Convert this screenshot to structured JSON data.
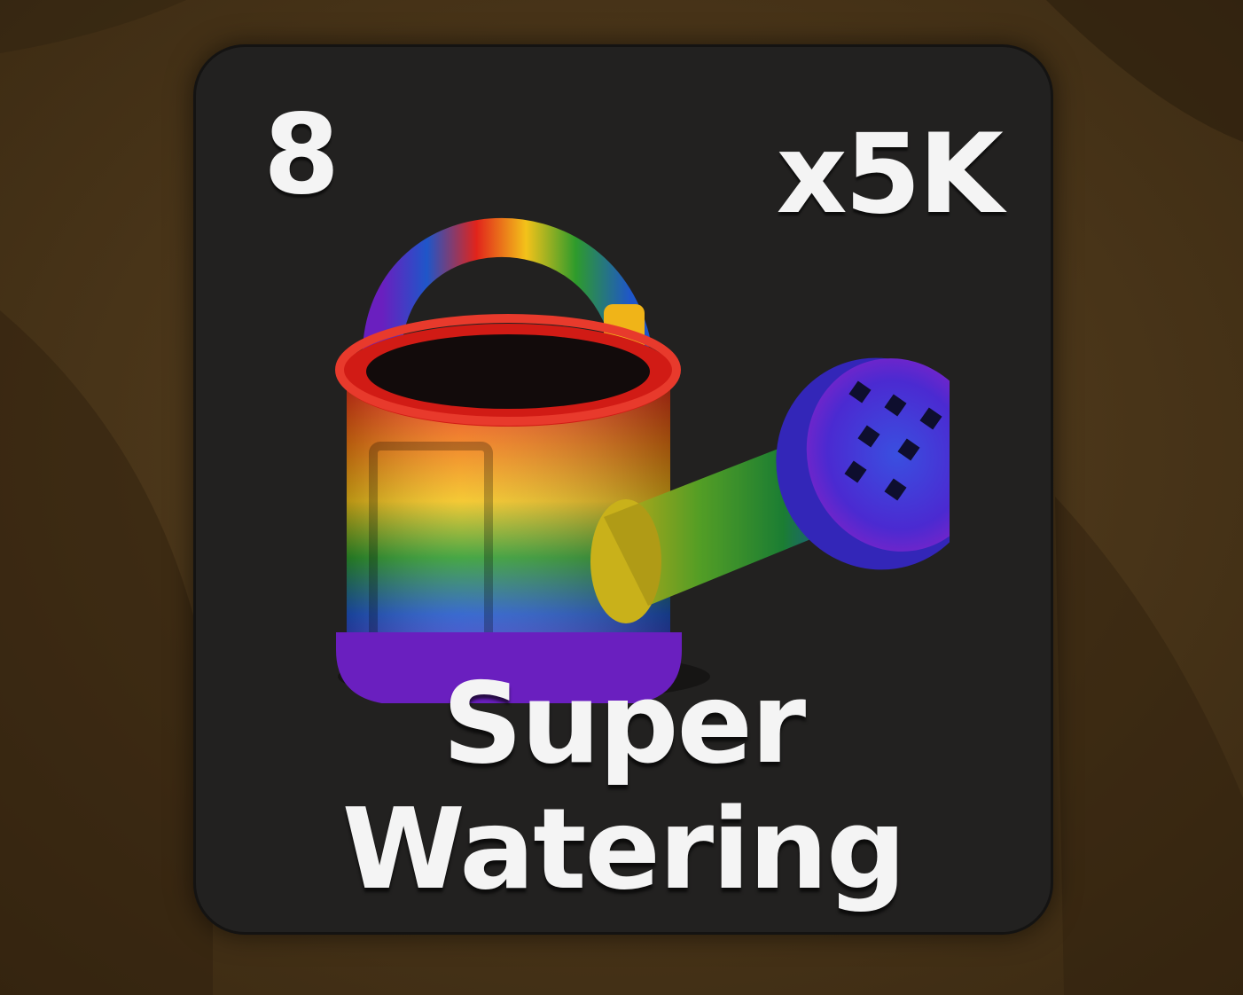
{
  "slot": {
    "number": "8",
    "count": "x5K",
    "name_line1": "Super",
    "name_line2": "Watering",
    "icon": "rainbow-watering-can-icon"
  },
  "colors": {
    "card_bg": "#222120",
    "text": "#f4f4f4",
    "background": "#4a3518"
  }
}
